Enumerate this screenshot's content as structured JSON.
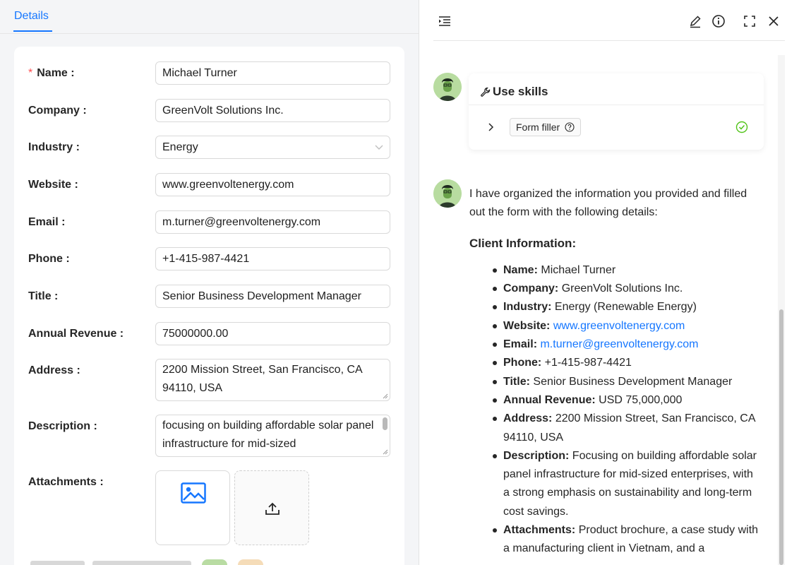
{
  "left": {
    "tab": "Details",
    "form": {
      "name_label": "Name :",
      "name_value": "Michael Turner",
      "company_label": "Company :",
      "company_value": "GreenVolt Solutions Inc.",
      "industry_label": "Industry :",
      "industry_value": "Energy",
      "website_label": "Website :",
      "website_value": "www.greenvoltenergy.com",
      "email_label": "Email :",
      "email_value": "m.turner@greenvoltenergy.com",
      "phone_label": "Phone :",
      "phone_value": "+1-415-987-4421",
      "title_label": "Title :",
      "title_value": "Senior Business Development Manager",
      "revenue_label": "Annual Revenue :",
      "revenue_value": "75000000.00",
      "address_label": "Address :",
      "address_value": "2200 Mission Street, San Francisco, CA 94110, USA",
      "description_label": "Description :",
      "description_value": "focusing on building affordable solar panel infrastructure for mid-sized",
      "attachments_label": "Attachments :"
    }
  },
  "right": {
    "skills": {
      "title": "Use skills",
      "skill_name": "Form filler"
    },
    "message": {
      "intro": "I have organized the information you provided and filled out the form with the following details:",
      "heading": "Client Information:",
      "items": [
        {
          "key": "Name:",
          "value": "Michael Turner"
        },
        {
          "key": "Company:",
          "value": "GreenVolt Solutions Inc."
        },
        {
          "key": "Industry:",
          "value": "Energy (Renewable Energy)"
        },
        {
          "key": "Website:",
          "value": "www.greenvoltenergy.com"
        },
        {
          "key": "Email:",
          "value": "m.turner@greenvoltenergy.com"
        },
        {
          "key": "Phone:",
          "value": "+1-415-987-4421"
        },
        {
          "key": "Title:",
          "value": "Senior Business Development Manager"
        },
        {
          "key": "Annual Revenue:",
          "value": "USD 75,000,000"
        },
        {
          "key": "Address:",
          "value": "2200 Mission Street, San Francisco, CA 94110, USA"
        },
        {
          "key": "Description:",
          "value": "Focusing on building affordable solar panel infrastructure for mid-sized enterprises, with a strong emphasis on sustainability and long-term cost savings."
        },
        {
          "key": "Attachments:",
          "value": "Product brochure, a case study with a manufacturing client in Vietnam, and a"
        }
      ]
    }
  },
  "colors": {
    "accent": "#1677ff",
    "required": "#ff4d4f",
    "success": "#52c41a",
    "avatar_bg": "#b8dca0"
  },
  "icons": [
    "collapse-panel-icon",
    "edit-icon",
    "info-icon",
    "fullscreen-icon",
    "close-icon",
    "wrench-icon",
    "chevron-right-icon",
    "question-circle-icon",
    "check-circle-icon",
    "image-icon",
    "upload-icon",
    "chevron-down-icon"
  ]
}
